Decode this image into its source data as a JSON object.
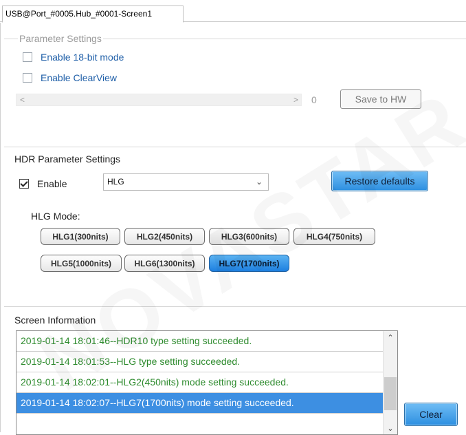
{
  "tab": {
    "label": "USB@Port_#0005.Hub_#0001-Screen1"
  },
  "parameter_settings": {
    "title": "Parameter Settings",
    "enable_18bit_label": "Enable 18-bit mode",
    "enable_18bit_checked": false,
    "enable_clearview_label": "Enable ClearView",
    "enable_clearview_checked": false,
    "slider_value": "0",
    "save_button": "Save to HW"
  },
  "hdr": {
    "title": "HDR Parameter Settings",
    "enable_label": "Enable",
    "enable_checked": true,
    "mode_select_value": "HLG",
    "restore_button": "Restore defaults",
    "hlg_mode_label": "HLG Mode:",
    "hlg_modes": [
      "HLG1(300nits)",
      "HLG2(450nits)",
      "HLG3(600nits)",
      "HLG4(750nits)",
      "HLG5(1000nits)",
      "HLG6(1300nits)",
      "HLG7(1700nits)"
    ],
    "selected_mode": "HLG7(1700nits)"
  },
  "screen_info": {
    "title": "Screen Information",
    "log": [
      "2019-01-14 18:01:46--HDR10 type setting succeeded.",
      "2019-01-14 18:01:53--HLG type setting succeeded.",
      "2019-01-14 18:02:01--HLG2(450nits) mode setting succeeded.",
      "2019-01-14 18:02:07--HLG7(1700nits) mode setting succeeded."
    ],
    "selected_index": 3,
    "clear_button": "Clear"
  },
  "watermark": {
    "text": "NOVASTAR TECH"
  },
  "colors": {
    "accent_blue": "#2d8fe0",
    "log_text_green": "#2e8b2e",
    "selection_blue": "#3d8fe2"
  }
}
